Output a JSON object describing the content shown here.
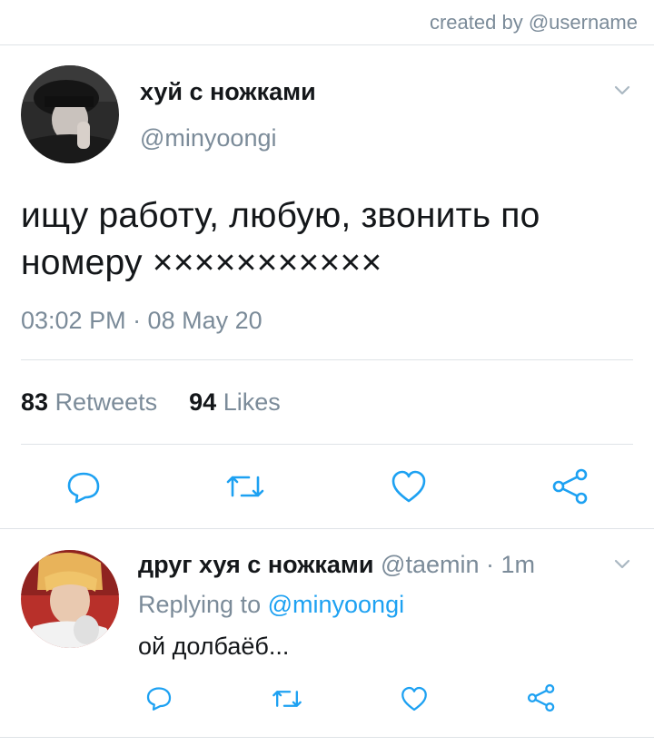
{
  "credit": "created by @username",
  "tweet": {
    "display_name": "хуй с ножками",
    "handle": "@minyoongi",
    "text": "ищу работу, любую, звонить по номеру ×××××××××××",
    "timestamp": "03:02 PM · 08 May 20",
    "retweets_count": "83",
    "retweets_label": "Retweets",
    "likes_count": "94",
    "likes_label": "Likes"
  },
  "reply": {
    "display_name": "друг хуя с ножками",
    "handle": "@taemin",
    "separator": "·",
    "time_ago": "1m",
    "replying_prefix": "Replying to",
    "replying_handle": "@minyoongi",
    "text": "ой долбаёб..."
  },
  "icons": {
    "reply": "reply-icon",
    "retweet": "retweet-icon",
    "like": "heart-icon",
    "share": "share-icon",
    "menu": "chevron-down-icon"
  },
  "colors": {
    "text": "#14171a",
    "secondary": "#7b8b99",
    "link": "#1da1f2",
    "divider": "#dfe3e7"
  }
}
